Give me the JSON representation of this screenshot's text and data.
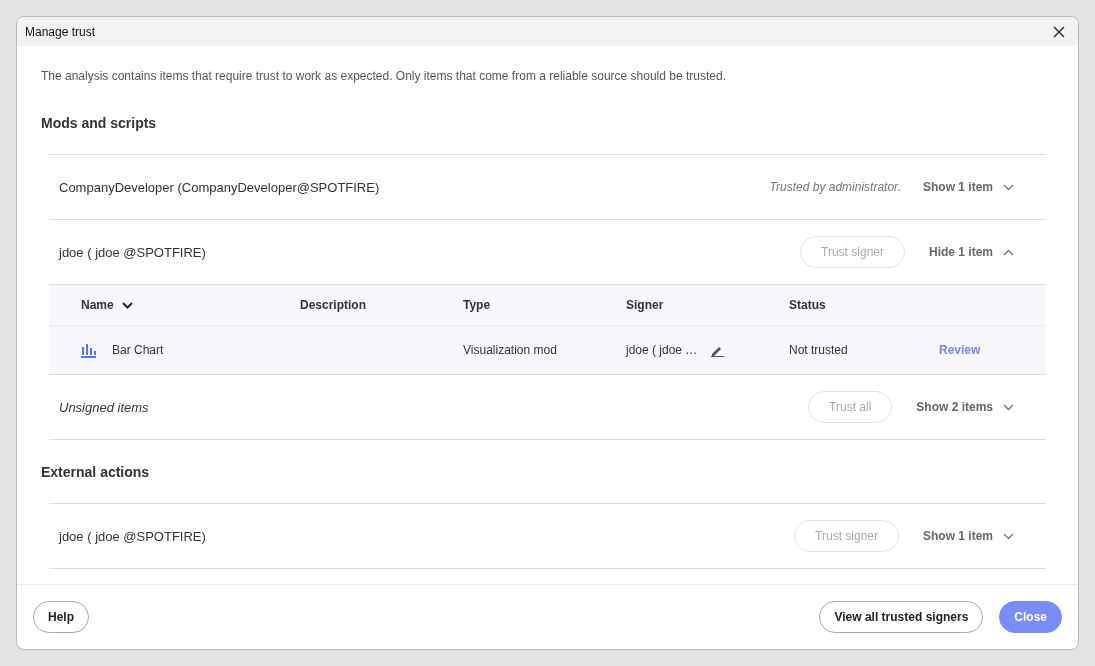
{
  "window": {
    "title": "Manage trust"
  },
  "intro": "The analysis contains items that require trust to work as expected. Only items that come from a reliable source should be trusted.",
  "sections": [
    {
      "title": "Mods and scripts",
      "groups": [
        {
          "kind": "signer",
          "name": "CompanyDeveloper (CompanyDeveloper@SPOTFIRE)",
          "note": "Trusted by administrator.",
          "toggle": "Show 1 item",
          "expanded": false
        },
        {
          "kind": "signer",
          "name": "jdoe ( jdoe @SPOTFIRE)",
          "button": {
            "label": "Trust signer",
            "disabled": true
          },
          "toggle": "Hide 1 item",
          "expanded": true,
          "table": {
            "columns": [
              {
                "label": "Name",
                "sorted": true
              },
              {
                "label": "Description",
                "sorted": false
              },
              {
                "label": "Type",
                "sorted": false
              },
              {
                "label": "Signer",
                "sorted": false
              },
              {
                "label": "Status",
                "sorted": false
              }
            ],
            "rows": [
              {
                "name": "Bar Chart",
                "description": "",
                "type": "Visualization mod",
                "signer": "jdoe ( jdoe  …",
                "status": "Not trusted",
                "action": "Review"
              }
            ]
          }
        },
        {
          "kind": "unsigned",
          "name": "Unsigned items",
          "button": {
            "label": "Trust all",
            "disabled": true
          },
          "toggle": "Show 2 items",
          "expanded": false
        }
      ]
    },
    {
      "title": "External actions",
      "groups": [
        {
          "kind": "signer",
          "name": "jdoe ( jdoe @SPOTFIRE)",
          "button": {
            "label": "Trust signer",
            "disabled": true
          },
          "toggle": "Show 1 item",
          "expanded": false
        }
      ]
    }
  ],
  "footer": {
    "help": "Help",
    "view_all": "View all trusted signers",
    "close": "Close"
  }
}
